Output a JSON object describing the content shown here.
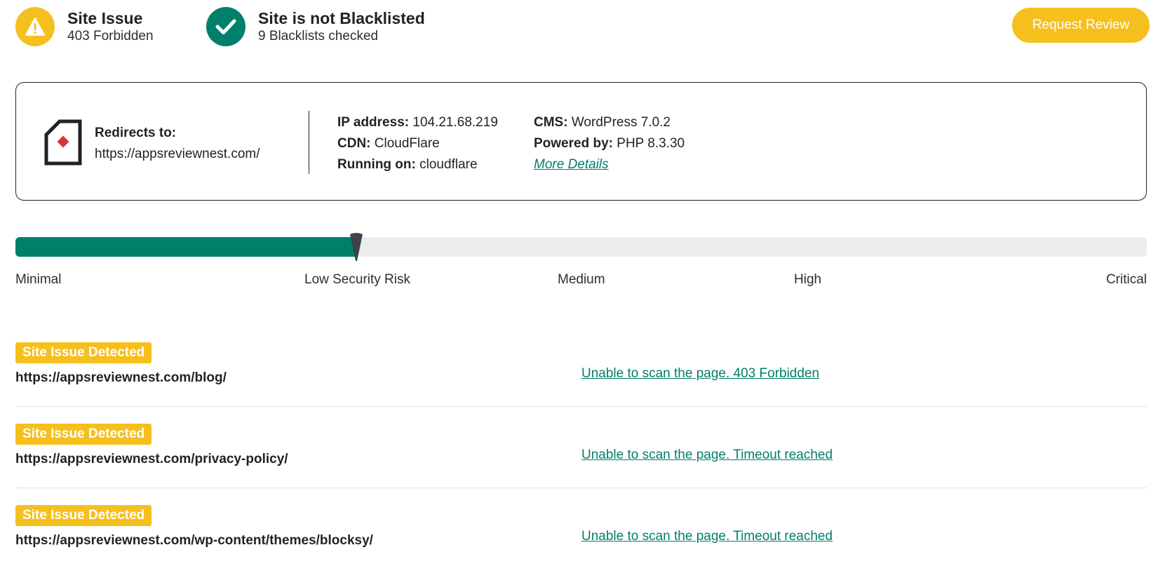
{
  "header": {
    "site_issue": {
      "title": "Site Issue",
      "subtitle": "403 Forbidden",
      "icon": "warning-icon",
      "color": "#f5bf1d"
    },
    "blacklist": {
      "title": "Site is not Blacklisted",
      "subtitle": "9 Blacklists checked",
      "icon": "checkmark-icon",
      "color": "#007f6a"
    },
    "request_review_label": "Request Review"
  },
  "info": {
    "redirect_label": "Redirects to:",
    "redirect_url": "https://appsreviewnest.com/",
    "ip_label": "IP address:",
    "ip_value": "104.21.68.219",
    "cdn_label": "CDN:",
    "cdn_value": "CloudFlare",
    "running_label": "Running on:",
    "running_value": "cloudflare",
    "cms_label": "CMS:",
    "cms_value": "WordPress 7.0.2",
    "powered_label": "Powered by:",
    "powered_value": "PHP 8.3.30",
    "more_details": "More Details"
  },
  "risk": {
    "level_fraction": 0.301,
    "labels": [
      "Minimal",
      "Low Security Risk",
      "Medium",
      "High",
      "Critical"
    ],
    "fill_color": "#007f6a",
    "track_color": "#ececec"
  },
  "scans": [
    {
      "badge": "Site Issue Detected",
      "url": "https://appsreviewnest.com/blog/",
      "message": "Unable to scan the page. 403 Forbidden"
    },
    {
      "badge": "Site Issue Detected",
      "url": "https://appsreviewnest.com/privacy-policy/",
      "message": "Unable to scan the page. Timeout reached"
    },
    {
      "badge": "Site Issue Detected",
      "url": "https://appsreviewnest.com/wp-content/themes/blocksy/",
      "message": "Unable to scan the page. Timeout reached"
    }
  ]
}
